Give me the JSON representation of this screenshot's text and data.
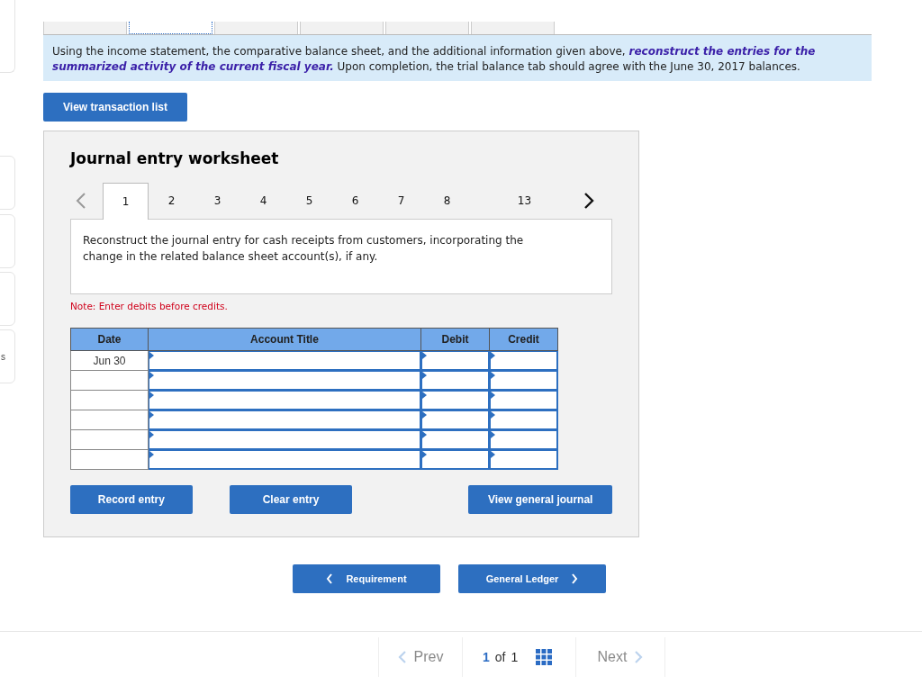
{
  "top_tabs": [
    {
      "selected": false
    },
    {
      "selected": true
    },
    {
      "selected": false
    },
    {
      "selected": false
    },
    {
      "selected": false
    },
    {
      "selected": false
    }
  ],
  "side_card_text": "s",
  "instructions": "Using the income statement, the comparative balance sheet, and the additional information given above, **reconstruct the entries for the summarized activity of the current fiscal year.**  Upon completion, the trial balance tab should agree with the June 30, 2017 balances.",
  "view_transaction_button": "View transaction list",
  "worksheet": {
    "title": "Journal entry worksheet",
    "entry_tabs": [
      {
        "label": "1",
        "selected": true
      },
      {
        "label": "2",
        "selected": false
      },
      {
        "label": "3",
        "selected": false
      },
      {
        "label": "4",
        "selected": false
      },
      {
        "label": "5",
        "selected": false
      },
      {
        "label": "6",
        "selected": false
      },
      {
        "label": "7",
        "selected": false
      },
      {
        "label": "8",
        "selected": false
      },
      {
        "label": "13",
        "selected": false
      }
    ],
    "prompt": "Reconstruct the journal entry for cash receipts from customers, incorporating the change in the related balance sheet account(s), if any.",
    "note": "Note: Enter debits before credits.",
    "table": {
      "columns": [
        "Date",
        "Account Title",
        "Debit",
        "Credit"
      ],
      "rows": [
        {
          "date": "Jun 30"
        },
        {},
        {},
        {},
        {},
        {}
      ]
    },
    "buttons": [
      "Record entry",
      "Clear entry",
      "View general journal"
    ]
  },
  "nav_buttons": {
    "back": "Requirement",
    "forward": "General Ledger"
  },
  "pagination": {
    "prev": {
      "label": "Prev",
      "disabled": true
    },
    "current": "1",
    "of": "of",
    "total": "1",
    "next": {
      "label": "Next",
      "disabled": true
    }
  }
}
